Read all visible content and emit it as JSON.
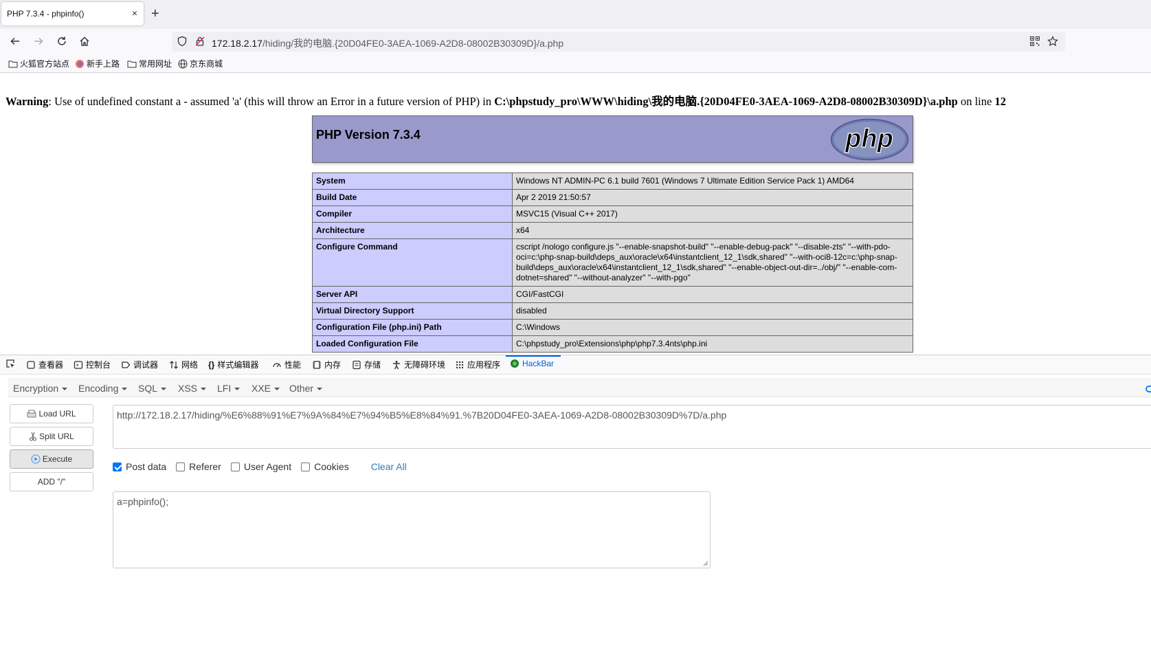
{
  "browser": {
    "tab_title": "PHP 7.3.4 - phpinfo()",
    "tab_close": "×",
    "new_tab": "+",
    "url_host": "172.18.2.17",
    "url_path": "/hiding/我的电脑.{20D04FE0-3AEA-1069-A2D8-08002B30309D}/a.php",
    "bookmarks": [
      "火狐官方站点",
      "新手上路",
      "常用网址",
      "京东商城"
    ]
  },
  "page": {
    "warning_label": "Warning",
    "warning_text": ": Use of undefined constant a - assumed 'a' (this will throw an Error in a future version of PHP) in ",
    "warning_file": "C:\\phpstudy_pro\\WWW\\hiding\\我的电脑.{20D04FE0-3AEA-1069-A2D8-08002B30309D}\\a.php",
    "warning_on_line": " on line ",
    "warning_line": "12",
    "php_version_title": "PHP Version 7.3.4",
    "logo_text": "php",
    "rows": [
      {
        "key": "System",
        "value": "Windows NT ADMIN-PC 6.1 build 7601 (Windows 7 Ultimate Edition Service Pack 1) AMD64"
      },
      {
        "key": "Build Date",
        "value": "Apr 2 2019 21:50:57"
      },
      {
        "key": "Compiler",
        "value": "MSVC15 (Visual C++ 2017)"
      },
      {
        "key": "Architecture",
        "value": "x64"
      },
      {
        "key": "Configure Command",
        "value": "cscript /nologo configure.js \"--enable-snapshot-build\" \"--enable-debug-pack\" \"--disable-zts\" \"--with-pdo-oci=c:\\php-snap-build\\deps_aux\\oracle\\x64\\instantclient_12_1\\sdk,shared\" \"--with-oci8-12c=c:\\php-snap-build\\deps_aux\\oracle\\x64\\instantclient_12_1\\sdk,shared\" \"--enable-object-out-dir=../obj/\" \"--enable-com-dotnet=shared\" \"--without-analyzer\" \"--with-pgo\""
      },
      {
        "key": "Server API",
        "value": "CGI/FastCGI"
      },
      {
        "key": "Virtual Directory Support",
        "value": "disabled"
      },
      {
        "key": "Configuration File (php.ini) Path",
        "value": "C:\\Windows"
      },
      {
        "key": "Loaded Configuration File",
        "value": "C:\\phpstudy_pro\\Extensions\\php\\php7.3.4nts\\php.ini"
      }
    ]
  },
  "devtools": {
    "tabs": [
      "查看器",
      "控制台",
      "调试器",
      "网络",
      "样式编辑器",
      "性能",
      "内存",
      "存储",
      "无障碍环境",
      "应用程序",
      "HackBar"
    ],
    "active_tab": "HackBar"
  },
  "hackbar": {
    "menu": [
      "Encryption",
      "Encoding",
      "SQL",
      "XSS",
      "LFI",
      "XXE",
      "Other"
    ],
    "buttons": {
      "load_url": "Load URL",
      "split_url": "Split URL",
      "execute": "Execute",
      "add_slash": "ADD \"/\""
    },
    "url_value": "http://172.18.2.17/hiding/%E6%88%91%E7%9A%84%E7%94%B5%E8%84%91.%7B20D04FE0-3AEA-1069-A2D8-08002B30309D%7D/a.php",
    "options": {
      "post_data": "Post data",
      "post_data_checked": true,
      "referer": "Referer",
      "referer_checked": false,
      "user_agent": "User Agent",
      "user_agent_checked": false,
      "cookies": "Cookies",
      "cookies_checked": false,
      "clear_all": "Clear All"
    },
    "post_value": "a=phpinfo();"
  }
}
